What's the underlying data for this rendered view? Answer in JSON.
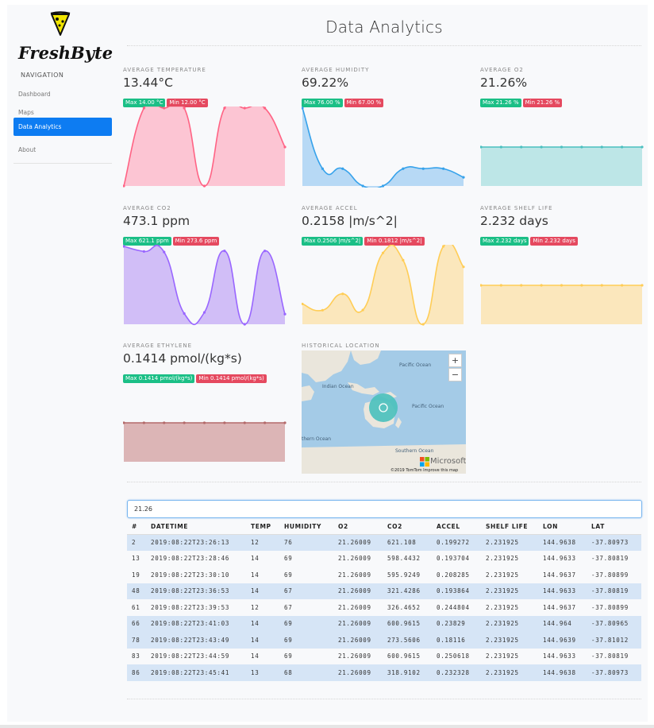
{
  "brand": {
    "name": "FreshByte"
  },
  "sidebar": {
    "heading": "NAVIGATION",
    "items": [
      {
        "label": "Dashboard",
        "active": false
      },
      {
        "label": "Maps",
        "active": false
      },
      {
        "label": "Data Analytics",
        "active": true
      },
      {
        "label": "About",
        "active": false
      }
    ]
  },
  "header": {
    "title": "Data Analytics"
  },
  "cards": {
    "temperature": {
      "label": "AVERAGE TEMPERATURE",
      "value": "13.44°C",
      "max": "Max 14.00 °C",
      "min": "Min 12.00 °C"
    },
    "humidity": {
      "label": "AVERAGE HUMIDITY",
      "value": "69.22%",
      "max": "Max 76.00 %",
      "min": "Min 67.00 %"
    },
    "o2": {
      "label": "AVERAGE O2",
      "value": "21.26%",
      "max": "Max 21.26 %",
      "min": "Min 21.26 %"
    },
    "co2": {
      "label": "AVERAGE CO2",
      "value": "473.1 ppm",
      "max": "Max 621.1 ppm",
      "min": "Min 273.6 ppm"
    },
    "accel": {
      "label": "AVERAGE ACCEL",
      "value": "0.2158 |m/s^2|",
      "max": "Max 0.2506 |m/s^2|",
      "min": "Min 0.1812 |m/s^2|"
    },
    "shelf": {
      "label": "AVERAGE SHELF LIFE",
      "value": "2.232 days",
      "max": "Max 2.232 days",
      "min": "Min 2.232 days"
    },
    "ethylene": {
      "label": "AVERAGE ETHYLENE",
      "value": "0.1414 pmol/(kg*s)",
      "max": "Max 0.1414 pmol/(kg*s)",
      "min": "Min 0.1414 pmol/(kg*s)"
    }
  },
  "map": {
    "label": "HISTORICAL LOCATION",
    "zoom_in": "+",
    "zoom_out": "−",
    "ocean_labels": [
      "Pacific Ocean",
      "Indian Ocean",
      "Pacific Ocean",
      "thern Ocean",
      "Southern Ocean"
    ],
    "provider": "Microsoft",
    "footer": "©2019 TomTom   Improve this map"
  },
  "search": {
    "value": "21.26"
  },
  "table": {
    "headers": [
      "#",
      "DATETIME",
      "TEMP",
      "HUMIDITY",
      "O2",
      "CO2",
      "ACCEL",
      "SHELF LIFE",
      "LON",
      "LAT"
    ],
    "rows": [
      {
        "hl": true,
        "cells": [
          "2",
          "2019:08:22T23:26:13",
          "12",
          "76",
          "21.26009",
          "621.108",
          "0.199272",
          "2.231925",
          "144.9638",
          "-37.80973"
        ]
      },
      {
        "hl": false,
        "cells": [
          "13",
          "2019:08:22T23:28:46",
          "14",
          "69",
          "21.26009",
          "598.4432",
          "0.193704",
          "2.231925",
          "144.9633",
          "-37.80819"
        ]
      },
      {
        "hl": false,
        "cells": [
          "19",
          "2019:08:22T23:30:10",
          "14",
          "69",
          "21.26009",
          "595.9249",
          "0.208285",
          "2.231925",
          "144.9637",
          "-37.80899"
        ]
      },
      {
        "hl": true,
        "cells": [
          "48",
          "2019:08:22T23:36:53",
          "14",
          "67",
          "21.26009",
          "321.4286",
          "0.193864",
          "2.231925",
          "144.9633",
          "-37.80819"
        ]
      },
      {
        "hl": false,
        "cells": [
          "61",
          "2019:08:22T23:39:53",
          "12",
          "67",
          "21.26009",
          "326.4652",
          "0.244804",
          "2.231925",
          "144.9637",
          "-37.80899"
        ]
      },
      {
        "hl": true,
        "cells": [
          "66",
          "2019:08:22T23:41:03",
          "14",
          "69",
          "21.26009",
          "600.9615",
          "0.23829",
          "2.231925",
          "144.964",
          "-37.80965"
        ]
      },
      {
        "hl": true,
        "cells": [
          "78",
          "2019:08:22T23:43:49",
          "14",
          "69",
          "21.26009",
          "273.5606",
          "0.18116",
          "2.231925",
          "144.9639",
          "-37.81012"
        ]
      },
      {
        "hl": false,
        "cells": [
          "83",
          "2019:08:22T23:44:59",
          "14",
          "69",
          "21.26009",
          "600.9615",
          "0.250618",
          "2.231925",
          "144.9633",
          "-37.80819"
        ]
      },
      {
        "hl": true,
        "cells": [
          "86",
          "2019:08:22T23:45:41",
          "13",
          "68",
          "21.26009",
          "318.9102",
          "0.232328",
          "2.231925",
          "144.9638",
          "-37.80973"
        ]
      }
    ]
  },
  "chart_data": [
    {
      "type": "area",
      "series": [
        {
          "values": [
            12,
            14,
            14,
            14,
            12,
            14,
            14,
            14,
            13
          ]
        }
      ],
      "ylim": [
        12,
        14
      ],
      "color": "#ff6384",
      "fill": "#fdbccb"
    },
    {
      "type": "area",
      "series": [
        {
          "values": [
            76,
            69,
            69,
            67,
            67,
            69,
            69,
            69,
            68
          ]
        }
      ],
      "ylim": [
        67,
        76
      ],
      "color": "#36a2eb",
      "fill": "#abd4f3"
    },
    {
      "type": "area",
      "series": [
        {
          "values": [
            21.26,
            21.26,
            21.26,
            21.26,
            21.26,
            21.26,
            21.26,
            21.26,
            21.26
          ]
        }
      ],
      "ylim": [
        21.26,
        21.26
      ],
      "color": "#4bc0c0",
      "fill": "#b3e3e3"
    },
    {
      "type": "area",
      "series": [
        {
          "values": [
            621.108,
            598.4432,
            595.9249,
            321.4286,
            326.4652,
            600.9615,
            273.5606,
            600.9615,
            318.9102
          ]
        }
      ],
      "ylim": [
        273.5606,
        621.108
      ],
      "color": "#9966ff",
      "fill": "#cab4f6"
    },
    {
      "type": "area",
      "series": [
        {
          "values": [
            0.199272,
            0.193704,
            0.208285,
            0.193864,
            0.244804,
            0.23829,
            0.18116,
            0.250618,
            0.232328
          ]
        }
      ],
      "ylim": [
        0.18116,
        0.250618
      ],
      "color": "#ffcd56",
      "fill": "#fce4b0"
    },
    {
      "type": "area",
      "series": [
        {
          "values": [
            2.231925,
            2.231925,
            2.231925,
            2.231925,
            2.231925,
            2.231925,
            2.231925,
            2.231925,
            2.231925
          ]
        }
      ],
      "ylim": [
        2.231925,
        2.231925
      ],
      "color": "#ffcd56",
      "fill": "#fce4b0"
    },
    {
      "type": "area",
      "series": [
        {
          "values": [
            0.1414,
            0.1414,
            0.1414,
            0.1414,
            0.1414,
            0.1414,
            0.1414,
            0.1414,
            0.1414
          ]
        }
      ],
      "ylim": [
        0.1414,
        0.1414
      ],
      "color": "#b46a6a",
      "fill": "#d7a9a9"
    }
  ]
}
